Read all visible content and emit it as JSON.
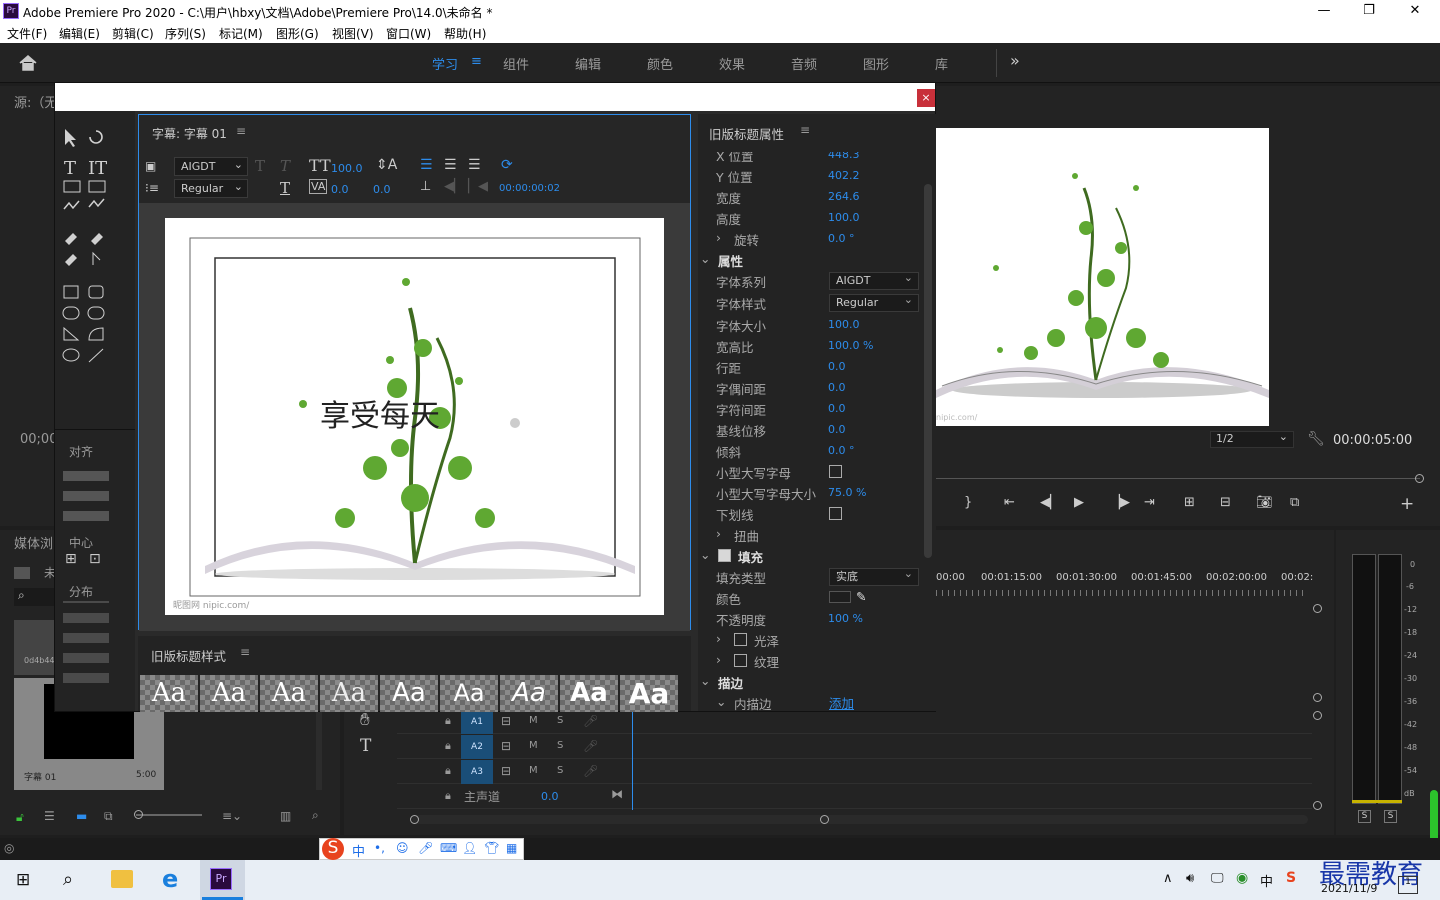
{
  "window": {
    "title": "Adobe Premiere Pro 2020 - C:\\用户\\hbxy\\文档\\Adobe\\Premiere Pro\\14.0\\未命名 *",
    "minimize": "—",
    "restore": "❐",
    "close": "✕",
    "icon": "Pr"
  },
  "menu": [
    "文件(F)",
    "编辑(E)",
    "剪辑(C)",
    "序列(S)",
    "标记(M)",
    "图形(G)",
    "视图(V)",
    "窗口(W)",
    "帮助(H)"
  ],
  "workspaces": [
    "学习",
    "组件",
    "编辑",
    "颜色",
    "效果",
    "音频",
    "图形",
    "库"
  ],
  "workspace_more": "»",
  "source_label": "源:（无",
  "timecode_left": "00;00",
  "media_browser": "媒体浏",
  "media_wei": "未",
  "align_panel": {
    "align": "对齐",
    "center": "中心",
    "distribute": "分布"
  },
  "editor": {
    "tab": "字幕: 字幕 01",
    "font": "AIGDT",
    "style": "Regular",
    "font_size": "100.0",
    "kerning": "0.0",
    "leading": "0.0",
    "timecode": "00:00:00:02",
    "canvas_text": "享受每天",
    "watermark": "昵图网 nipic.com/"
  },
  "props": {
    "title": "旧版标题属性",
    "rows": [
      {
        "label": "X 位置",
        "value": "448.3"
      },
      {
        "label": "Y 位置",
        "value": "402.2"
      },
      {
        "label": "宽度",
        "value": "264.6"
      },
      {
        "label": "高度",
        "value": "100.0"
      },
      {
        "label": "旋转",
        "value": "0.0 °"
      }
    ],
    "section_attr": "属性",
    "font_family_label": "字体系列",
    "font_family": "AIGDT",
    "font_style_label": "字体样式",
    "font_style": "Regular",
    "attr_rows": [
      {
        "label": "字体大小",
        "value": "100.0"
      },
      {
        "label": "宽高比",
        "value": "100.0 %"
      },
      {
        "label": "行距",
        "value": "0.0"
      },
      {
        "label": "字偶间距",
        "value": "0.0"
      },
      {
        "label": "字符间距",
        "value": "0.0"
      },
      {
        "label": "基线位移",
        "value": "0.0"
      },
      {
        "label": "倾斜",
        "value": "0.0 °"
      }
    ],
    "small_caps": "小型大写字母",
    "small_caps_size": "小型大写字母大小",
    "small_caps_size_val": "75.0 %",
    "underline": "下划线",
    "distort": "扭曲",
    "fill": "填充",
    "fill_type_label": "填充类型",
    "fill_type": "实底",
    "color_label": "颜色",
    "opacity_label": "不透明度",
    "opacity": "100 %",
    "sheen": "光泽",
    "texture": "纹理",
    "stroke": "描边",
    "inner_stroke": "内描边",
    "add": "添加"
  },
  "styles_panel": {
    "title": "旧版标题样式",
    "swatch": "Aa"
  },
  "program": {
    "zoom": "1/2",
    "timecode": "00:00:05:00",
    "watermark": "nipic.com/"
  },
  "timeline": {
    "ruler": [
      "00:00",
      "00:01:15:00",
      "00:01:30:00",
      "00:01:45:00",
      "00:02:00:00",
      "00:02:"
    ],
    "tracks": [
      {
        "id": "A1"
      },
      {
        "id": "A2"
      },
      {
        "id": "A3"
      }
    ],
    "m": "M",
    "s": "S",
    "master": "主声道",
    "master_val": "0.0"
  },
  "meter": {
    "scale": [
      "0",
      "-6",
      "-12",
      "-18",
      "-24",
      "-30",
      "-36",
      "-42",
      "-48",
      "-54",
      "dB"
    ],
    "solo": "S"
  },
  "project": {
    "clip_name": "字幕 01",
    "clip_dur": "5:00",
    "thumb_id": "0d4b44"
  },
  "ime": {
    "cn": "中",
    "punct": "•,"
  },
  "taskbar": {
    "date": "2021/11/9",
    "ime": "中",
    "brand": "最需教育",
    "notify": "1"
  }
}
